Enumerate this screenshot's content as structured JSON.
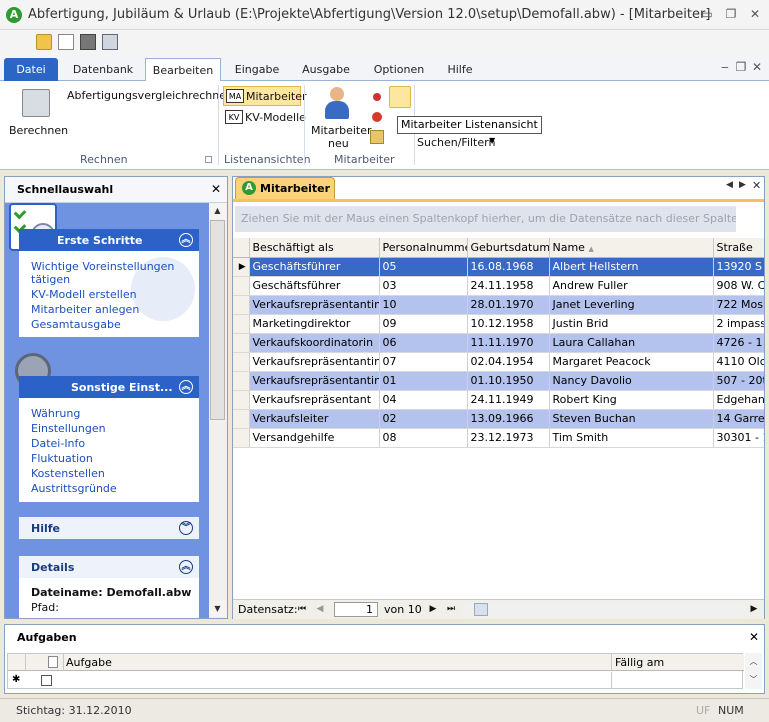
{
  "window": {
    "title": "Abfertigung, Jubiläum & Urlaub (E:\\Projekte\\Abfertigung\\Version 12.0\\setup\\Demofall.abw) - [Mitarbeiter]",
    "app_icon_letter": "A"
  },
  "ribbon": {
    "tabs": [
      "Datei",
      "Datenbank",
      "Bearbeiten",
      "Eingabe",
      "Ausgabe",
      "Optionen",
      "Hilfe"
    ],
    "active_tab": "Bearbeiten",
    "rechnen": {
      "berechnen_label": "Berechnen",
      "vergleich_label": "Abfertigungsvergleichrechner",
      "group_label": "Rechnen"
    },
    "listenansichten": {
      "mitarbeiter_label": "Mitarbeiter",
      "mitarbeiter_icon_text": "MA",
      "kv_label": "KV-Modelle",
      "kv_icon_text": "KV",
      "group_label": "Listenansichten"
    },
    "mitarbeiter": {
      "neu_label_line1": "Mitarbeiter",
      "neu_label_line2": "neu",
      "group_label": "Mitarbeiter",
      "suchen_label": "Suchen/Filtern"
    },
    "tooltip": "Mitarbeiter Listenansicht"
  },
  "schnellauswahl": {
    "title": "Schnellauswahl",
    "erste_schritte": {
      "title": "Erste Schritte",
      "items": [
        "Wichtige Voreinstellungen",
        "tätigen",
        "KV-Modell erstellen",
        "Mitarbeiter anlegen",
        "Gesamtausgabe"
      ]
    },
    "sonstige": {
      "title": "Sonstige Einst...",
      "items": [
        "Währung",
        "Einstellungen",
        "Datei-Info",
        "Fluktuation",
        "Kostenstellen",
        "Austrittsgründe"
      ]
    },
    "hilfe": {
      "title": "Hilfe"
    },
    "details": {
      "title": "Details",
      "dateiname": "Dateiname: Demofall.abw",
      "pfad": "Pfad:"
    }
  },
  "document": {
    "tab_label": "Mitarbeiter",
    "group_hint": "Ziehen Sie mit der Maus einen Spaltenkopf hierher, um die Datensätze nach dieser Spalte zu gruppieren",
    "columns": [
      "Beschäftigt als",
      "Personalnummer",
      "Geburtsdatum",
      "Name",
      "Straße"
    ],
    "sort_indicator": "▲",
    "rows": [
      [
        "Geschäftsführer",
        "05",
        "16.08.1968",
        "Albert Hellstern",
        "13920 S"
      ],
      [
        "Geschäftsführer",
        "03",
        "24.11.1958",
        "Andrew Fuller",
        "908 W. C"
      ],
      [
        "Verkaufsrepräsentantin",
        "10",
        "28.01.1970",
        "Janet Leverling",
        "722 Mos"
      ],
      [
        "Marketingdirektor",
        "09",
        "10.12.1958",
        "Justin Brid",
        "2 impass"
      ],
      [
        "Verkaufskoordinatorin",
        "06",
        "11.11.1970",
        "Laura Callahan",
        "4726 - 1"
      ],
      [
        "Verkaufsrepräsentantin",
        "07",
        "02.04.1954",
        "Margaret Peacock",
        "4110 Olc"
      ],
      [
        "Verkaufsrepräsentantin",
        "01",
        "01.10.1950",
        "Nancy Davolio",
        "507 - 20t"
      ],
      [
        "Verkaufsrepräsentant",
        "04",
        "24.11.1949",
        "Robert King",
        "Edgehan"
      ],
      [
        "Verkaufsleiter",
        "02",
        "13.09.1966",
        "Steven Buchan",
        "14 Garre"
      ],
      [
        "Versandgehilfe",
        "08",
        "23.12.1973",
        "Tim Smith",
        "30301 - 1"
      ]
    ],
    "selected_row": 0,
    "nav": {
      "label": "Datensatz:",
      "current": "1",
      "of_label": "von 10"
    }
  },
  "aufgaben": {
    "title": "Aufgaben",
    "columns": [
      "Aufgabe",
      "Fällig am"
    ],
    "new_row_marker": "✱"
  },
  "statusbar": {
    "stichtag": "Stichtag: 31.12.2010",
    "uf": "UF",
    "num": "NUM"
  }
}
